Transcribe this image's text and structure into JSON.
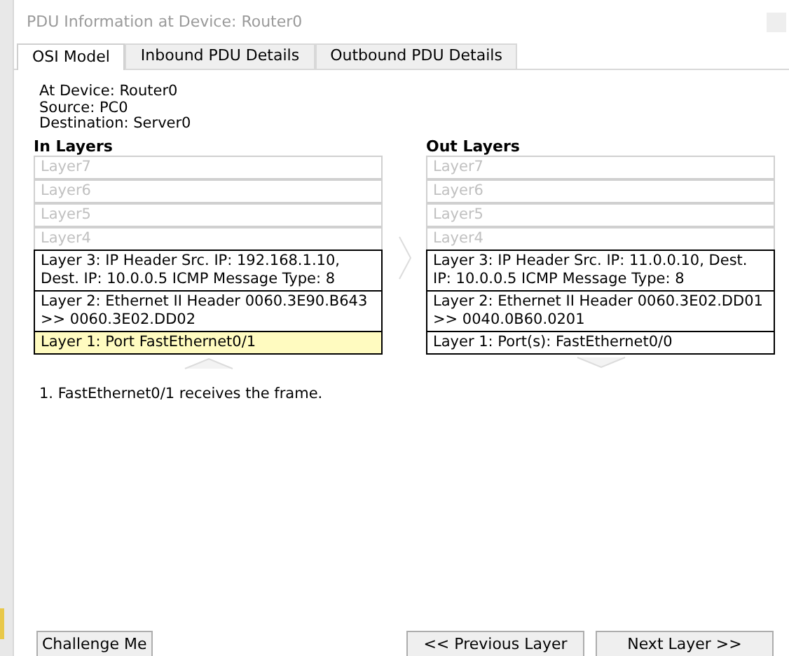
{
  "window": {
    "title": "PDU Information at Device: Router0"
  },
  "tabs": [
    {
      "label": "OSI Model",
      "selected": true
    },
    {
      "label": "Inbound PDU Details",
      "selected": false
    },
    {
      "label": "Outbound PDU Details",
      "selected": false
    }
  ],
  "info": [
    "At Device: Router0",
    "Source: PC0",
    "Destination: Server0"
  ],
  "in_layers": {
    "title": "In Layers",
    "layers": [
      {
        "text": "Layer7",
        "active": false,
        "selected": false
      },
      {
        "text": "Layer6",
        "active": false,
        "selected": false
      },
      {
        "text": "Layer5",
        "active": false,
        "selected": false
      },
      {
        "text": "Layer4",
        "active": false,
        "selected": false
      },
      {
        "text": "Layer 3: IP Header Src. IP: 192.168.1.10, Dest. IP: 10.0.0.5 ICMP Message Type: 8",
        "active": true,
        "selected": false
      },
      {
        "text": "Layer 2: Ethernet II Header 0060.3E90.B643 >> 0060.3E02.DD02",
        "active": true,
        "selected": false
      },
      {
        "text": "Layer 1: Port FastEthernet0/1",
        "active": true,
        "selected": true
      }
    ]
  },
  "out_layers": {
    "title": "Out Layers",
    "layers": [
      {
        "text": "Layer7",
        "active": false,
        "selected": false
      },
      {
        "text": "Layer6",
        "active": false,
        "selected": false
      },
      {
        "text": "Layer5",
        "active": false,
        "selected": false
      },
      {
        "text": "Layer4",
        "active": false,
        "selected": false
      },
      {
        "text": "Layer 3: IP Header Src. IP: 11.0.0.10, Dest. IP: 10.0.0.5 ICMP Message Type: 8",
        "active": true,
        "selected": false
      },
      {
        "text": "Layer 2: Ethernet II Header 0060.3E02.DD01 >> 0040.0B60.0201",
        "active": true,
        "selected": false
      },
      {
        "text": "Layer 1: Port(s): FastEthernet0/0",
        "active": true,
        "selected": false
      }
    ]
  },
  "description": [
    "1. FastEthernet0/1 receives the frame."
  ],
  "buttons": {
    "left": [
      "Challenge Me"
    ],
    "right": [
      "<< Previous Layer",
      "Next Layer >>"
    ]
  }
}
